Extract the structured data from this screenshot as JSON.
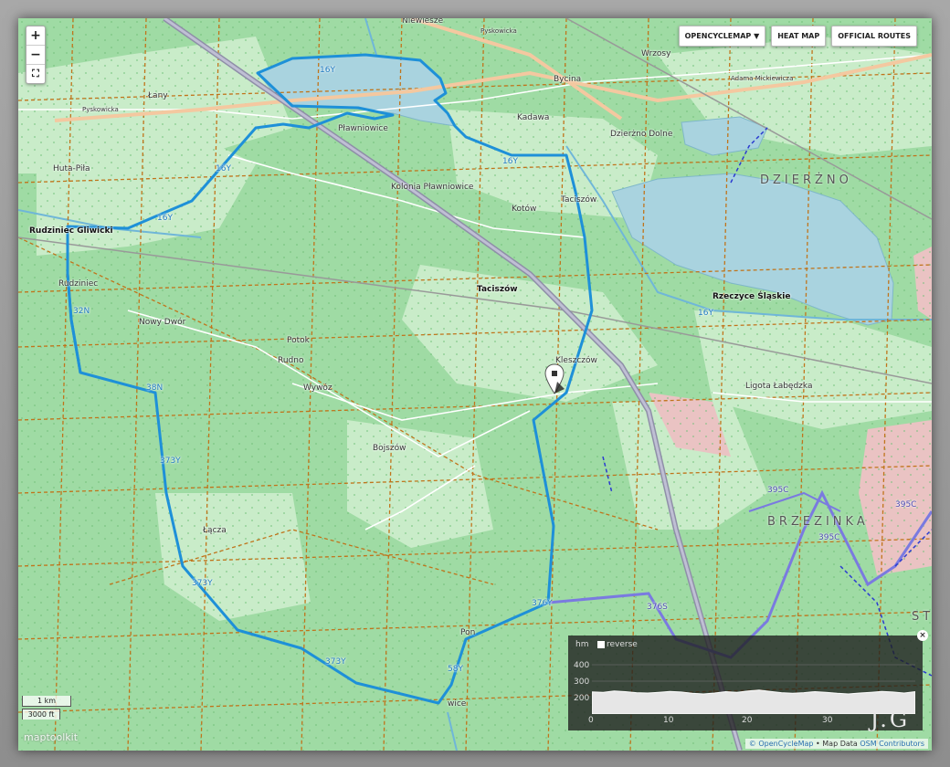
{
  "map": {
    "zoom_in": "+",
    "zoom_out": "−",
    "fullscreen": "⛶",
    "buttons": {
      "layer": "OPENCYCLEMAP ▼",
      "heat": "HEAT MAP",
      "official": "OFFICIAL ROUTES"
    },
    "place_labels": {
      "niewiesze": "Niewiesze",
      "wrzosy": "Wrzosy",
      "lany": "Łany",
      "bycina": "Bycina",
      "kadawa": "Kadawa",
      "dzierzno_dolne": "Dzierżno Dolne",
      "plawniowice": "Pławniowice",
      "huta_pila": "Huta-Piła",
      "kolonia": "Kolonia Pławniowice",
      "taciszow_n": "Taciszów",
      "kotow": "Kotów",
      "dzierzno": "DZIERŻNO",
      "rudziniec_gliwicki": "Rudziniec Gliwicki",
      "rudziniec": "Rudziniec",
      "taciszow": "Taciszów",
      "rzeczyce": "Rzeczyce Śląskie",
      "nowy_dwor": "Nowy Dwór",
      "potok": "Potok",
      "rudno": "Rudno",
      "wywoz": "Wywóz",
      "kleszczow": "Kleszczów",
      "ligota": "Ligota Łabędzka",
      "bojszow": "Bojszów",
      "brzezinka": "BRZEZINKA",
      "laczna": "Łącza",
      "pon": "Pon",
      "wice": "wice",
      "st": "ST"
    },
    "road_labels": {
      "pyskowicka": "Pyskowicka",
      "pyskowicka2": "Pyskowicka",
      "adama": "Adama Mickiewicza"
    },
    "route_labels": {
      "r16y_a": "16Y",
      "r16y_b": "16Y",
      "r16y_c": "16Y",
      "r16y_d": "16Y",
      "r16y_e": "16Y",
      "r32n": "32N",
      "r38n": "38N",
      "r373y_a": "373Y",
      "r373y_b": "373Y",
      "r373y_c": "373Y",
      "r376_a": "376Y",
      "r376_b": "376S",
      "r395c_a": "395C",
      "r395c_b": "395C",
      "r395c_c": "395C",
      "r58y": "58Y"
    },
    "scale": {
      "km": "1 km",
      "ft": "3000 ft"
    },
    "brand": "maptoolkit",
    "attribution": {
      "ocm": "© OpenCycleMap",
      "md": "• Map Data",
      "osm": "OSM Contributors"
    }
  },
  "elevation": {
    "unit": "hm",
    "reverse_label": "reverse",
    "reverse_checked": false,
    "y_labels": [
      "400",
      "300",
      "200"
    ],
    "x_labels": [
      "0",
      "10",
      "20",
      "30"
    ],
    "signature": "J.G",
    "close": "×",
    "profile_hm": [
      235,
      232,
      240,
      236,
      230,
      228,
      232,
      238,
      234,
      226,
      222,
      228,
      236,
      232,
      240,
      246,
      238,
      230,
      226,
      230,
      236,
      232,
      226,
      222,
      228,
      232,
      238,
      234,
      228,
      236
    ],
    "total_km": 34
  },
  "colors": {
    "route": "#1e90d8",
    "water": "#a9d3df",
    "forest": "#9fdba4"
  }
}
